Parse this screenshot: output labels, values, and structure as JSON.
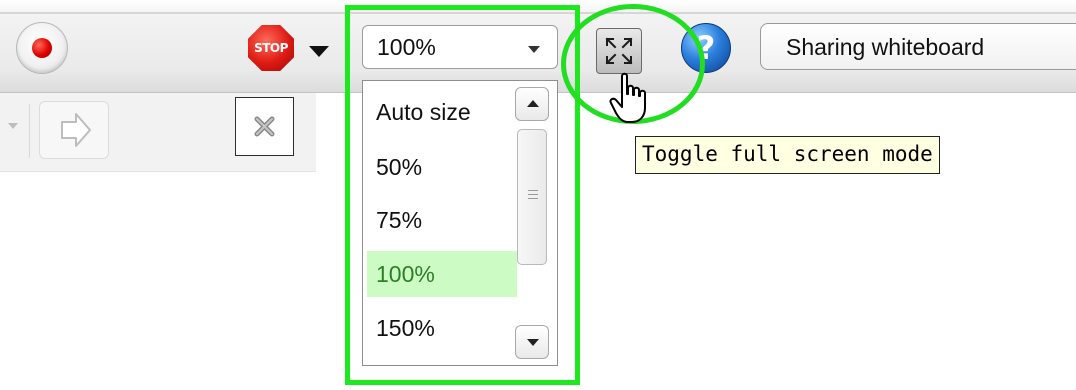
{
  "toolbar": {
    "record_icon": "record-icon",
    "stop_icon": "stop-sign-icon",
    "stop_text": "STOP",
    "zoom": {
      "value": "100%",
      "options": [
        "Auto size",
        "50%",
        "75%",
        "100%",
        "150%"
      ],
      "selected": "100%"
    },
    "fullscreen_icon": "fullscreen-toggle-icon",
    "help_icon": "help-icon",
    "help_text": "?",
    "status_text": "Sharing whiteboard"
  },
  "panel": {
    "back_icon": "chevron-down-icon",
    "forward_icon": "arrow-right-icon",
    "close_icon": "close-icon"
  },
  "tooltip": {
    "text": "Toggle full screen mode"
  },
  "colors": {
    "highlight": "#1ee81e",
    "selected_bg": "#ccfcc4",
    "selected_text": "#2f7e2a",
    "tooltip_bg": "#ffffe1",
    "record_red": "#e00000",
    "help_blue": "#2b7fde"
  }
}
